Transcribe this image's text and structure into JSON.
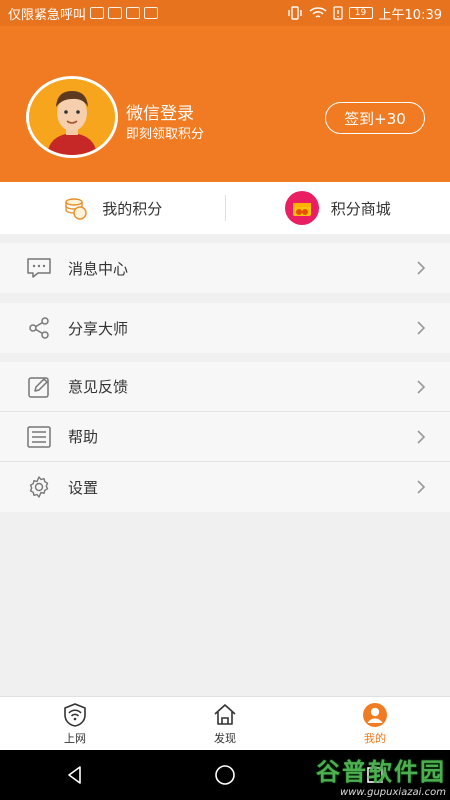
{
  "status_bar": {
    "carrier": "仅限紧急呼叫",
    "battery": "19",
    "time": "上午10:39"
  },
  "profile": {
    "title": "微信登录",
    "subtitle": "即刻领取积分",
    "checkin_label": "签到+30"
  },
  "points": {
    "my_points_label": "我的积分",
    "mall_label": "积分商城"
  },
  "menu": {
    "messages": "消息中心",
    "share": "分享大师",
    "feedback": "意见反馈",
    "help": "帮助",
    "settings": "设置"
  },
  "tabs": {
    "internet": "上网",
    "discover": "发现",
    "mine": "我的"
  },
  "watermark": {
    "title": "谷普软件园",
    "url": "www.gupuxiazai.com"
  },
  "colors": {
    "accent": "#f07b22",
    "background": "#f0f0f0"
  }
}
